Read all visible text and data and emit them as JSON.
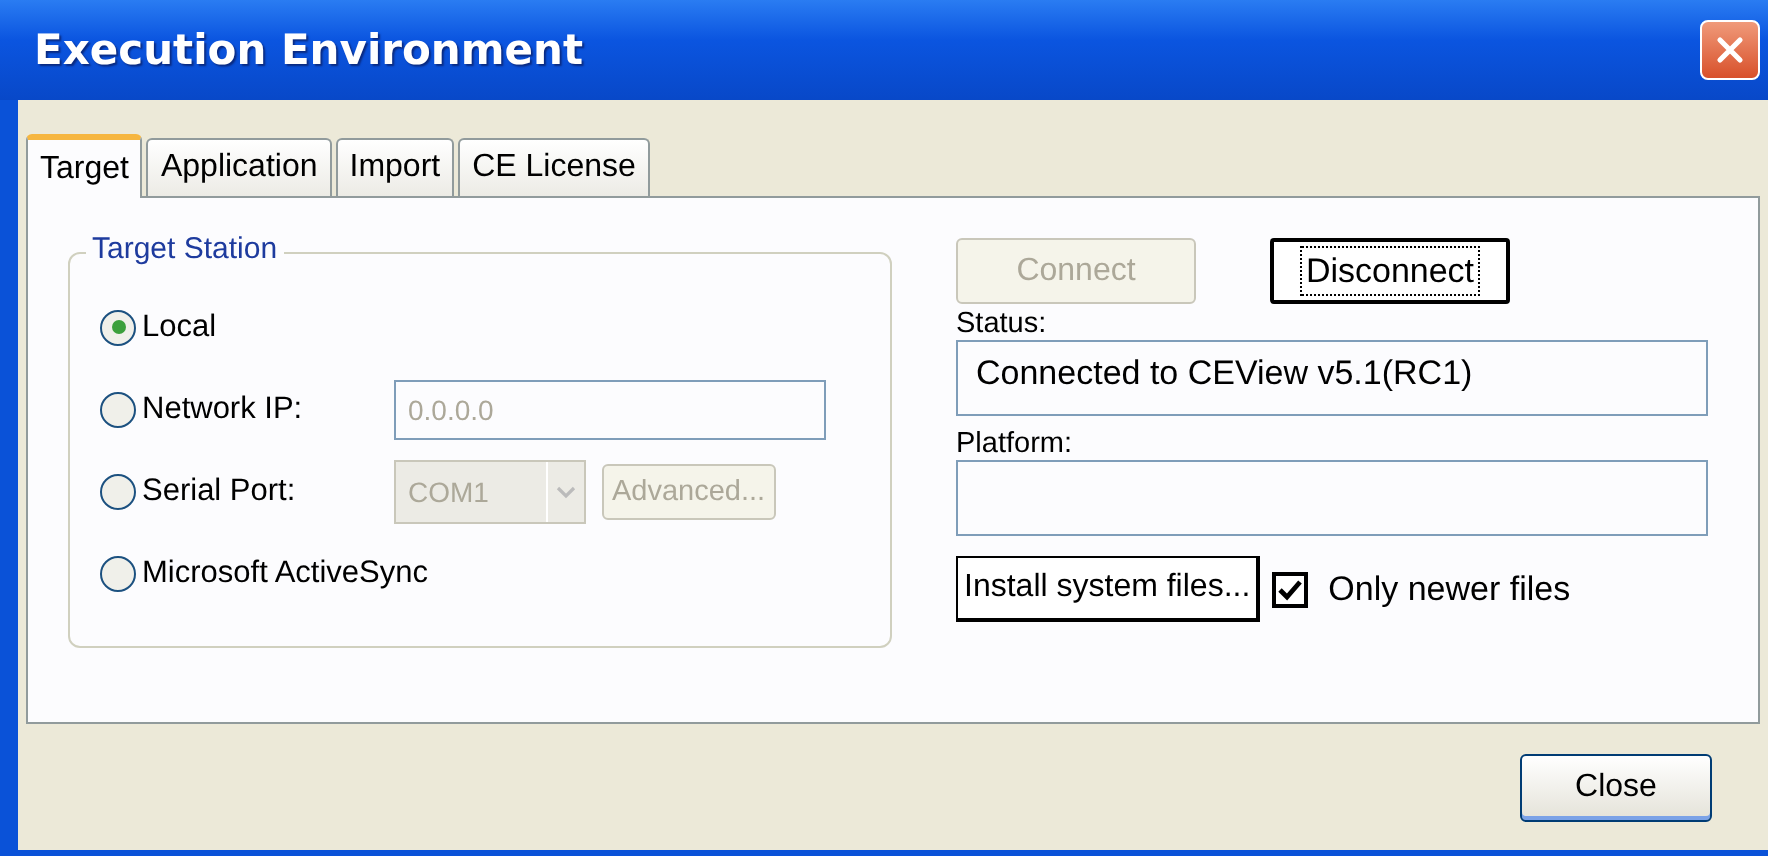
{
  "window": {
    "title": "Execution Environment"
  },
  "tabs": [
    {
      "label": "Target",
      "selected": true
    },
    {
      "label": "Application",
      "selected": false
    },
    {
      "label": "Import",
      "selected": false
    },
    {
      "label": "CE License",
      "selected": false
    }
  ],
  "target_station": {
    "title": "Target Station",
    "options": [
      {
        "kind": "plain",
        "label": "Local",
        "selected": true
      },
      {
        "kind": "field",
        "label": "Network IP:",
        "selected": false,
        "value": "0.0.0.0",
        "disabled": true
      },
      {
        "kind": "combo",
        "label": "Serial Port:",
        "selected": false,
        "value": "COM1",
        "disabled": true,
        "button": {
          "label": "Advanced...",
          "disabled": true
        }
      },
      {
        "kind": "plain",
        "label": "Microsoft ActiveSync",
        "selected": false
      }
    ]
  },
  "connect_buttons": [
    {
      "label": "Connect",
      "disabled": true,
      "focused": false
    },
    {
      "label": "Disconnect",
      "disabled": false,
      "focused": true
    }
  ],
  "status": {
    "label": "Status:",
    "value": "Connected to CEView v5.1(RC1)"
  },
  "platform": {
    "label": "Platform:"
  },
  "install_button": {
    "label": "Install system files..."
  },
  "only_newer": {
    "label": "Only newer files",
    "checked": true
  },
  "close_button": {
    "label": "Close"
  }
}
